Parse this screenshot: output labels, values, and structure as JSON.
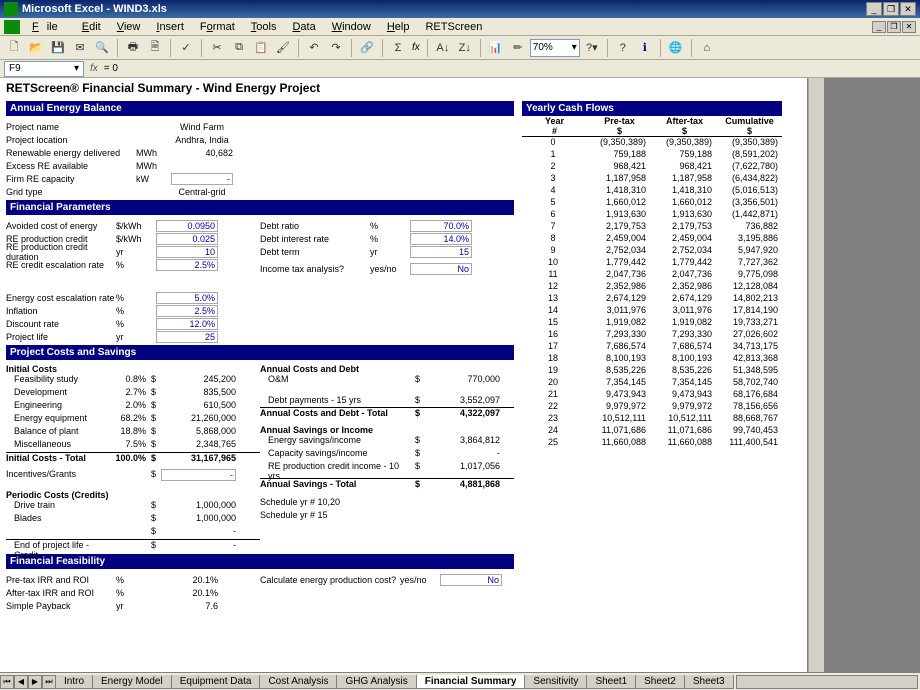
{
  "window": {
    "title": "Microsoft Excel - WIND3.xls"
  },
  "menu": [
    "File",
    "Edit",
    "View",
    "Insert",
    "Format",
    "Tools",
    "Data",
    "Window",
    "Help",
    "RETScreen"
  ],
  "namebox": "F9",
  "formula": "= 0",
  "zoom": "70%",
  "doc": {
    "title": "RETScreen® Financial Summary - Wind Energy Project",
    "aeb_header": "Annual Energy Balance",
    "aeb": {
      "project_name_l": "Project name",
      "project_name_v": "Wind Farm",
      "project_loc_l": "Project location",
      "project_loc_v": "Andhra, India",
      "re_delivered_l": "Renewable energy delivered",
      "re_delivered_u": "MWh",
      "re_delivered_v": "40,682",
      "excess_l": "Excess RE available",
      "excess_u": "MWh",
      "firm_l": "Firm RE capacity",
      "firm_u": "kW",
      "firm_v": "-",
      "grid_l": "Grid type",
      "grid_v": "Central-grid"
    },
    "fp_header": "Financial Parameters",
    "fp": {
      "avoided_l": "Avoided cost of energy",
      "avoided_u": "$/kWh",
      "avoided_v": "0.0950",
      "recredit_l": "RE production credit",
      "recredit_u": "$/kWh",
      "recredit_v": "0.025",
      "recredit_dur_l": "RE production credit duration",
      "recredit_dur_u": "yr",
      "recredit_dur_v": "10",
      "reesc_l": "RE credit escalation rate",
      "reesc_u": "%",
      "reesc_v": "2.5%",
      "debtratio_l": "Debt ratio",
      "debtratio_u": "%",
      "debtratio_v": "70.0%",
      "debtint_l": "Debt interest rate",
      "debtint_u": "%",
      "debtint_v": "14.0%",
      "debtterm_l": "Debt term",
      "debtterm_u": "yr",
      "debtterm_v": "15",
      "incometax_l": "Income tax analysis?",
      "incometax_u": "yes/no",
      "incometax_v": "No",
      "energyesc_l": "Energy cost escalation rate",
      "energyesc_u": "%",
      "energyesc_v": "5.0%",
      "infl_l": "Inflation",
      "infl_u": "%",
      "infl_v": "2.5%",
      "disc_l": "Discount rate",
      "disc_u": "%",
      "disc_v": "12.0%",
      "life_l": "Project life",
      "life_u": "yr",
      "life_v": "25"
    },
    "pcs_header": "Project Costs and Savings",
    "pcs": {
      "ic_h": "Initial Costs",
      "rows": [
        {
          "n": "Feasibility study",
          "p": "0.8%",
          "a": "245,200"
        },
        {
          "n": "Development",
          "p": "2.7%",
          "a": "835,500"
        },
        {
          "n": "Engineering",
          "p": "2.0%",
          "a": "610,500"
        },
        {
          "n": "Energy equipment",
          "p": "68.2%",
          "a": "21,260,000"
        },
        {
          "n": "Balance of plant",
          "p": "18.8%",
          "a": "5,868,000"
        },
        {
          "n": "Miscellaneous",
          "p": "7.5%",
          "a": "2,348,765"
        }
      ],
      "total_l": "Initial Costs - Total",
      "total_p": "100.0%",
      "total_a": "31,167,965",
      "incent_l": "Incentives/Grants",
      "incent_v": "-",
      "periodic_h": "Periodic Costs (Credits)",
      "drive_l": "Drive train",
      "drive_v": "1,000,000",
      "blades_l": "Blades",
      "blades_v": "1,000,000",
      "eol_l": "End of project life - Credit",
      "acd_h": "Annual Costs and Debt",
      "om_l": "O&M",
      "om_v": "770,000",
      "debtpay_l": "Debt payments - 15 yrs",
      "debtpay_v": "3,552,097",
      "acd_tot_l": "Annual Costs and Debt - Total",
      "acd_tot_v": "4,322,097",
      "asi_h": "Annual Savings or Income",
      "esi_l": "Energy savings/income",
      "esi_v": "3,864,812",
      "csi_l": "Capacity savings/income",
      "csi_v": "-",
      "reci_l": "RE production credit income - 10 yrs",
      "reci_v": "1,017,056",
      "ast_l": "Annual Savings - Total",
      "ast_v": "4,881,868",
      "sched1_l": "Schedule yr # 10,20",
      "sched2_l": "Schedule yr # 15"
    },
    "ff_header": "Financial Feasibility",
    "ff": {
      "pretax_l": "Pre-tax IRR and ROI",
      "pretax_u": "%",
      "pretax_v": "20.1%",
      "aftertax_l": "After-tax IRR and ROI",
      "aftertax_u": "%",
      "aftertax_v": "20.1%",
      "payback_l": "Simple Payback",
      "payback_u": "yr",
      "payback_v": "7.6",
      "calc_l": "Calculate energy production cost?",
      "calc_u": "yes/no",
      "calc_v": "No"
    },
    "cf_header": "Yearly Cash Flows",
    "cf_cols": [
      "Year",
      "Pre-tax",
      "After-tax",
      "Cumulative"
    ],
    "cf_sub": [
      "#",
      "$",
      "$",
      "$"
    ],
    "cf": [
      [
        "0",
        "(9,350,389)",
        "(9,350,389)",
        "(9,350,389)"
      ],
      [
        "1",
        "759,188",
        "759,188",
        "(8,591,202)"
      ],
      [
        "2",
        "968,421",
        "968,421",
        "(7,622,780)"
      ],
      [
        "3",
        "1,187,958",
        "1,187,958",
        "(6,434,822)"
      ],
      [
        "4",
        "1,418,310",
        "1,418,310",
        "(5,016,513)"
      ],
      [
        "5",
        "1,660,012",
        "1,660,012",
        "(3,356,501)"
      ],
      [
        "6",
        "1,913,630",
        "1,913,630",
        "(1,442,871)"
      ],
      [
        "7",
        "2,179,753",
        "2,179,753",
        "736,882"
      ],
      [
        "8",
        "2,459,004",
        "2,459,004",
        "3,195,886"
      ],
      [
        "9",
        "2,752,034",
        "2,752,034",
        "5,947,920"
      ],
      [
        "10",
        "1,779,442",
        "1,779,442",
        "7,727,362"
      ],
      [
        "11",
        "2,047,736",
        "2,047,736",
        "9,775,098"
      ],
      [
        "12",
        "2,352,986",
        "2,352,986",
        "12,128,084"
      ],
      [
        "13",
        "2,674,129",
        "2,674,129",
        "14,802,213"
      ],
      [
        "14",
        "3,011,976",
        "3,011,976",
        "17,814,190"
      ],
      [
        "15",
        "1,919,082",
        "1,919,082",
        "19,733,271"
      ],
      [
        "16",
        "7,293,330",
        "7,293,330",
        "27,026,602"
      ],
      [
        "17",
        "7,686,574",
        "7,686,574",
        "34,713,175"
      ],
      [
        "18",
        "8,100,193",
        "8,100,193",
        "42,813,368"
      ],
      [
        "19",
        "8,535,226",
        "8,535,226",
        "51,348,595"
      ],
      [
        "20",
        "7,354,145",
        "7,354,145",
        "58,702,740"
      ],
      [
        "21",
        "9,473,943",
        "9,473,943",
        "68,176,684"
      ],
      [
        "22",
        "9,979,972",
        "9,979,972",
        "78,156,656"
      ],
      [
        "23",
        "10,512,111",
        "10,512,111",
        "88,668,767"
      ],
      [
        "24",
        "11,071,686",
        "11,071,686",
        "99,740,453"
      ],
      [
        "25",
        "11,660,088",
        "11,660,088",
        "111,400,541"
      ]
    ]
  },
  "tabs": [
    "Intro",
    "Energy Model",
    "Equipment Data",
    "Cost Analysis",
    "GHG Analysis",
    "Financial Summary",
    "Sensitivity",
    "Sheet1",
    "Sheet2",
    "Sheet3"
  ],
  "active_tab": "Financial Summary"
}
